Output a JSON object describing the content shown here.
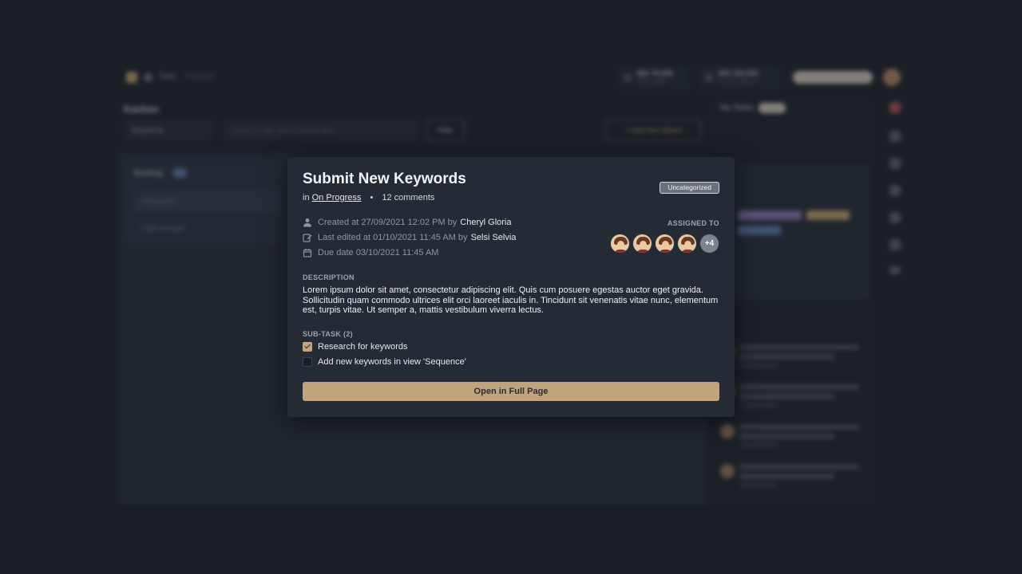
{
  "background": {
    "breadcrumb": [
      "Task",
      "Kanban"
    ],
    "stats": [
      {
        "value": "$50 70,000",
        "label": "Total budget"
      },
      {
        "value": "$50 160,000",
        "label": "Current balance"
      }
    ],
    "page_title": "Kanban",
    "view_select": "Sequence",
    "search_placeholder": "Search for task name or board name",
    "filter_label": "Filter",
    "add_board_label": "+ Add New Board",
    "column_title": "Backlog",
    "card_label": "Introduction",
    "add_task_label": "+ Add new task",
    "right_title": "My Tasks"
  },
  "modal": {
    "title": "Submit New Keywords",
    "in_prefix": "in",
    "status_link": "On Progress",
    "separator": "•",
    "comments": "12 comments",
    "category": "Uncategorized",
    "created": {
      "text": "Created at 27/09/2021 12:02 PM by",
      "user": "Cheryl Gloria",
      "icon": "user-icon"
    },
    "edited": {
      "text": "Last edited at 01/10/2021 11:45 AM by",
      "user": "Selsi Selvia",
      "icon": "edit-icon"
    },
    "due": {
      "text": "Due date 03/10/2021 11:45 AM",
      "icon": "calendar-icon"
    },
    "assigned_label": "ASSIGNED TO",
    "assignee_count_extra": "+4",
    "description_label": "DESCRIPTION",
    "description": "Lorem ipsum dolor sit amet, consectetur adipiscing elit. Quis cum posuere egestas auctor eget gravida. Sollicitudin quam commodo ultrices elit orci laoreet iaculis in. Tincidunt sit venenatis vitae nunc, elementum est, turpis vitae. Ut semper a, mattis vestibulum viverra lectus.",
    "subtask_label": "SUB-TASK (2)",
    "subtasks": [
      {
        "label": "Research for keywords",
        "checked": true
      },
      {
        "label": "Add new keywords in view 'Sequence'",
        "checked": false
      }
    ],
    "open_button": "Open in Full Page"
  },
  "colors": {
    "accent": "#c1a37c",
    "modal_bg": "#252b34",
    "page_bg": "#1a1e25"
  }
}
